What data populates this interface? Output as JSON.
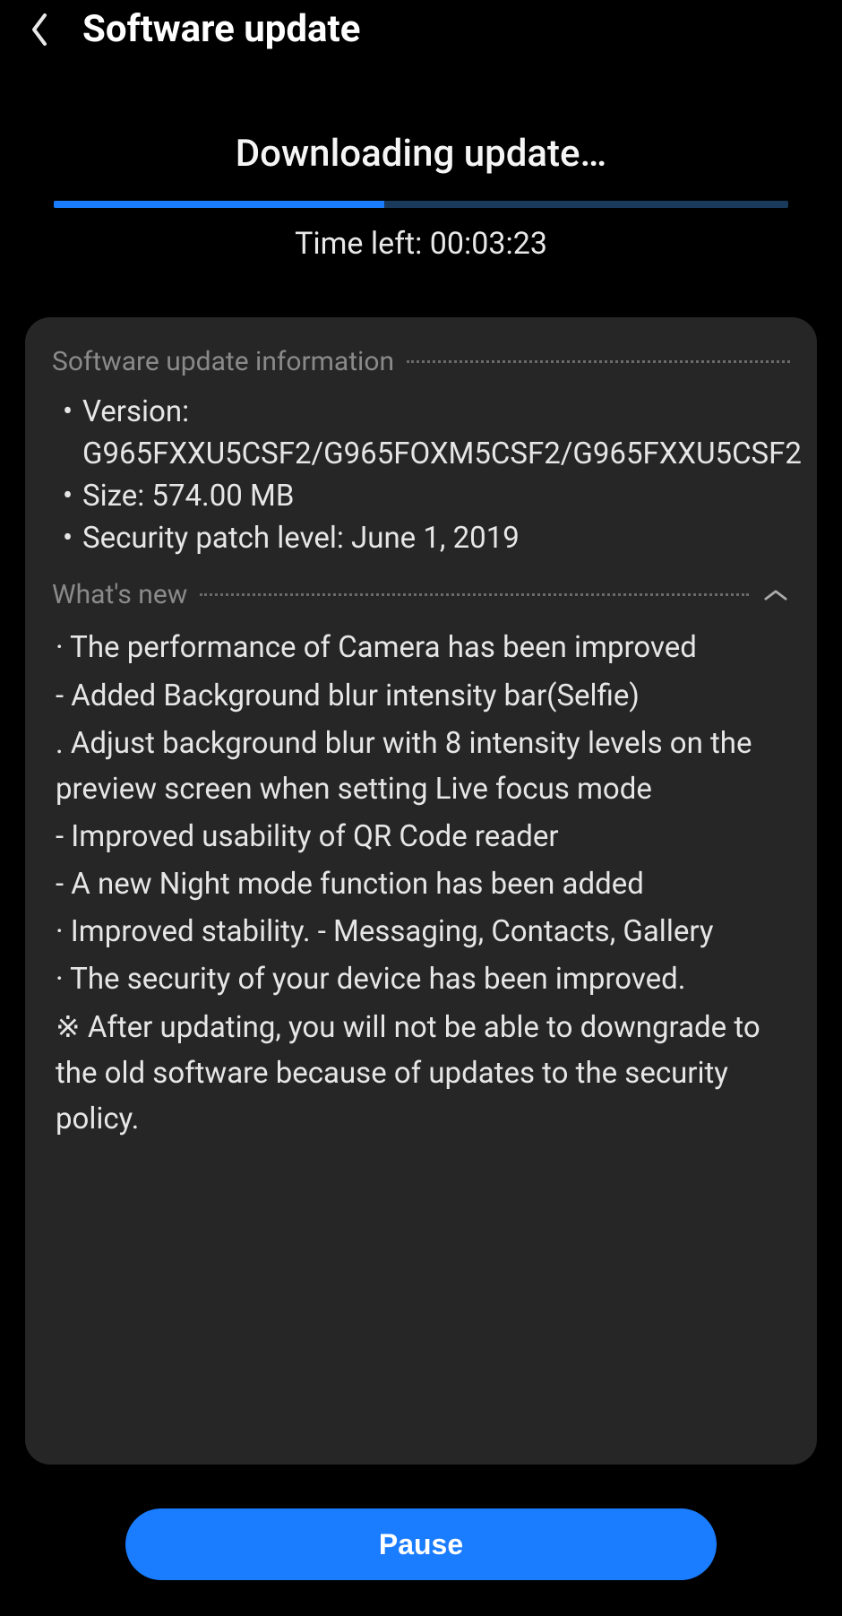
{
  "header": {
    "title": "Software update"
  },
  "download": {
    "status": "Downloading update…",
    "progress_percent": 45,
    "time_left_label": "Time left: 00:03:23"
  },
  "info": {
    "section_label": "Software update information",
    "version_label": "Version: G965FXXU5CSF2/G965FOXM5CSF2/G965FXXU5CSF2",
    "size_label": "Size: 574.00 MB",
    "security_label": "Security patch level: June 1, 2019"
  },
  "whatsnew": {
    "section_label": "What's new",
    "line1": "· The performance of Camera has been improved",
    "line2": " - Added Background blur intensity bar(Selfie)",
    "line3": "  . Adjust background blur with 8 intensity levels on the preview screen when setting Live focus mode",
    "line4": " - Improved usability of QR Code reader",
    "line5": " - A new Night mode function has been added",
    "line6": "· Improved stability. - Messaging, Contacts, Gallery",
    "line7": "· The security of your device has been improved.",
    "line8": "※ After updating, you will not be able to downgrade to the old software because of updates to the security policy."
  },
  "actions": {
    "pause_label": "Pause"
  },
  "colors": {
    "accent": "#1a7cff",
    "card_bg": "#262626",
    "muted": "#8a8a8a"
  }
}
